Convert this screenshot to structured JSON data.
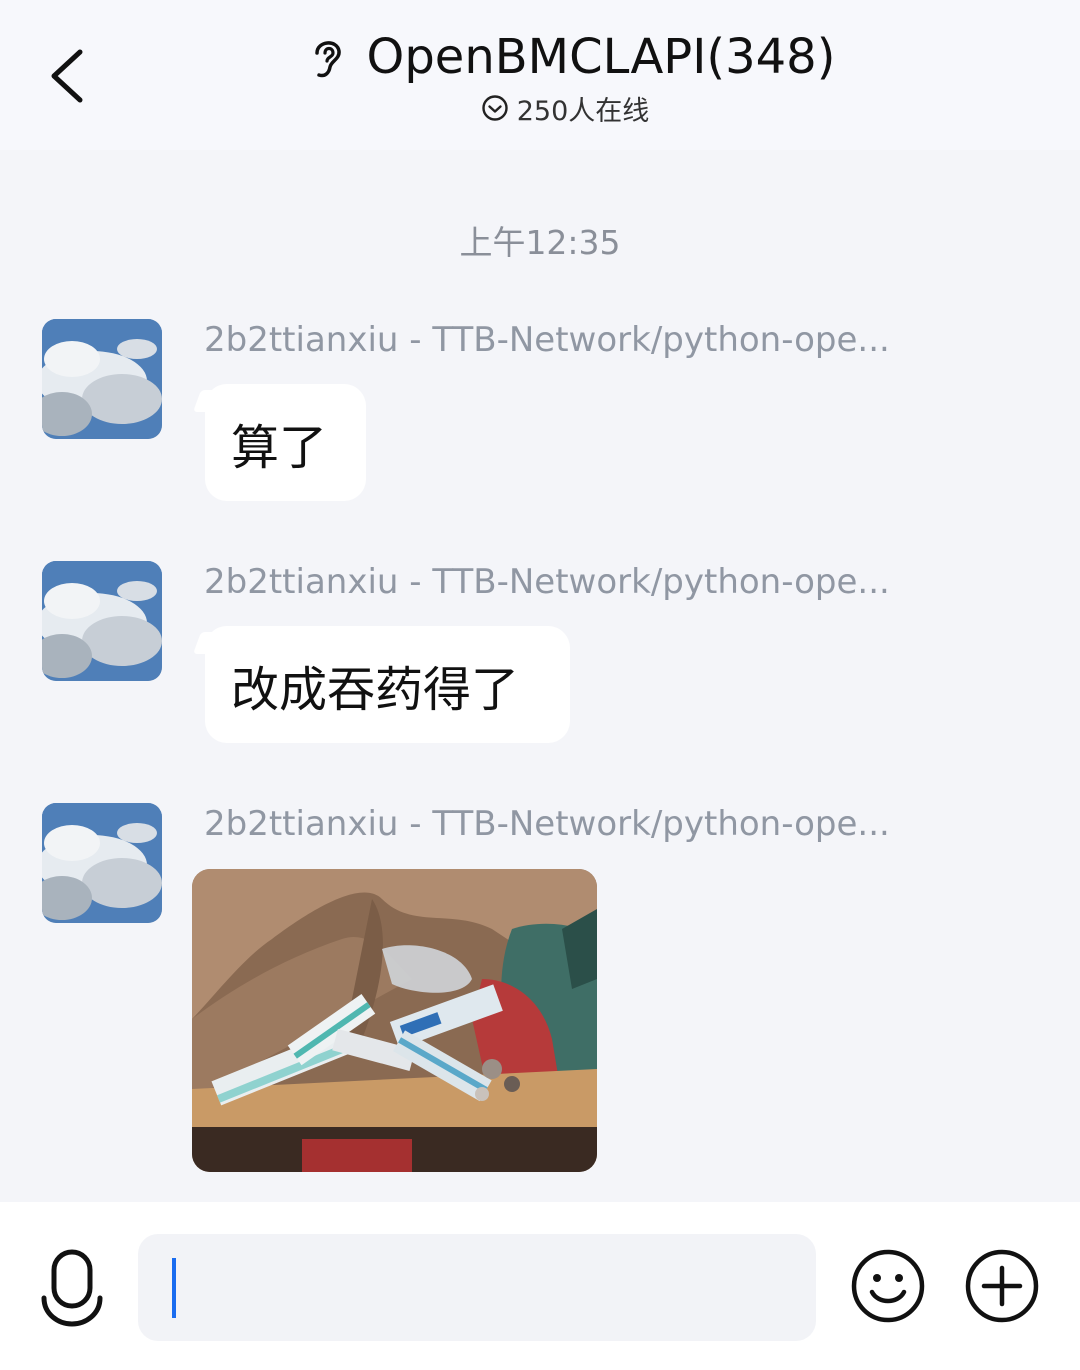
{
  "header": {
    "title": "OpenBMCLAPI(348)",
    "online": "250人在线",
    "back_icon": "chevron-left-icon",
    "title_icon": "ear-icon",
    "online_icon": "check-circle-icon"
  },
  "chat": {
    "timestamp": "上午12:35",
    "messages": [
      {
        "sender": "2b2ttianxiu - TTB-Network/python-ope...",
        "text": "算了"
      },
      {
        "sender": "2b2ttianxiu - TTB-Network/python-ope...",
        "text": "改成吞药得了"
      },
      {
        "sender": "2b2ttianxiu - TTB-Network/python-ope...",
        "image": "photo-of-medicine-boxes"
      }
    ]
  },
  "input_bar": {
    "text_value": "",
    "mic_icon": "microphone-icon",
    "emoji_icon": "smiley-icon",
    "plus_icon": "plus-circle-icon"
  },
  "colors": {
    "background": "#f4f5f9",
    "header_bg": "#f7f8fc",
    "bubble": "#ffffff",
    "caret": "#1a6cf0",
    "sender_text": "#9097a3"
  }
}
